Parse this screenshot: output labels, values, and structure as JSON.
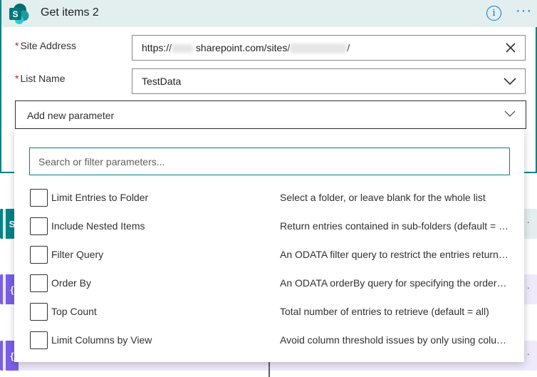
{
  "header": {
    "title": "Get items 2",
    "sp_logo_letter": "S",
    "accent_color": "#038387"
  },
  "fields": {
    "site_address": {
      "label": "Site Address",
      "required": "*",
      "value_prefix": "https://",
      "value_middle": "sharepoint.com/sites/",
      "value_suffix": "/"
    },
    "list_name": {
      "label": "List Name",
      "required": "*",
      "value": "TestData"
    }
  },
  "add_parameter": {
    "label": "Add new parameter"
  },
  "dropdown": {
    "search_placeholder": "Search or filter parameters...",
    "options": [
      {
        "label": "Limit Entries to Folder",
        "description": "Select a folder, or leave blank for the whole list",
        "checked": false
      },
      {
        "label": "Include Nested Items",
        "description": "Return entries contained in sub-folders (default = true)",
        "checked": false
      },
      {
        "label": "Filter Query",
        "description": "An ODATA filter query to restrict the entries returned",
        "checked": false
      },
      {
        "label": "Order By",
        "description": "An ODATA orderBy query for specifying the order of entries",
        "checked": false
      },
      {
        "label": "Top Count",
        "description": "Total number of entries to retrieve (default = all)",
        "checked": false
      },
      {
        "label": "Limit Columns by View",
        "description": "Avoid column threshold issues by only using columns defined in a view",
        "checked": false
      }
    ]
  },
  "background": {
    "sp_letter": "S",
    "var_symbol": "{",
    "more": "·"
  }
}
